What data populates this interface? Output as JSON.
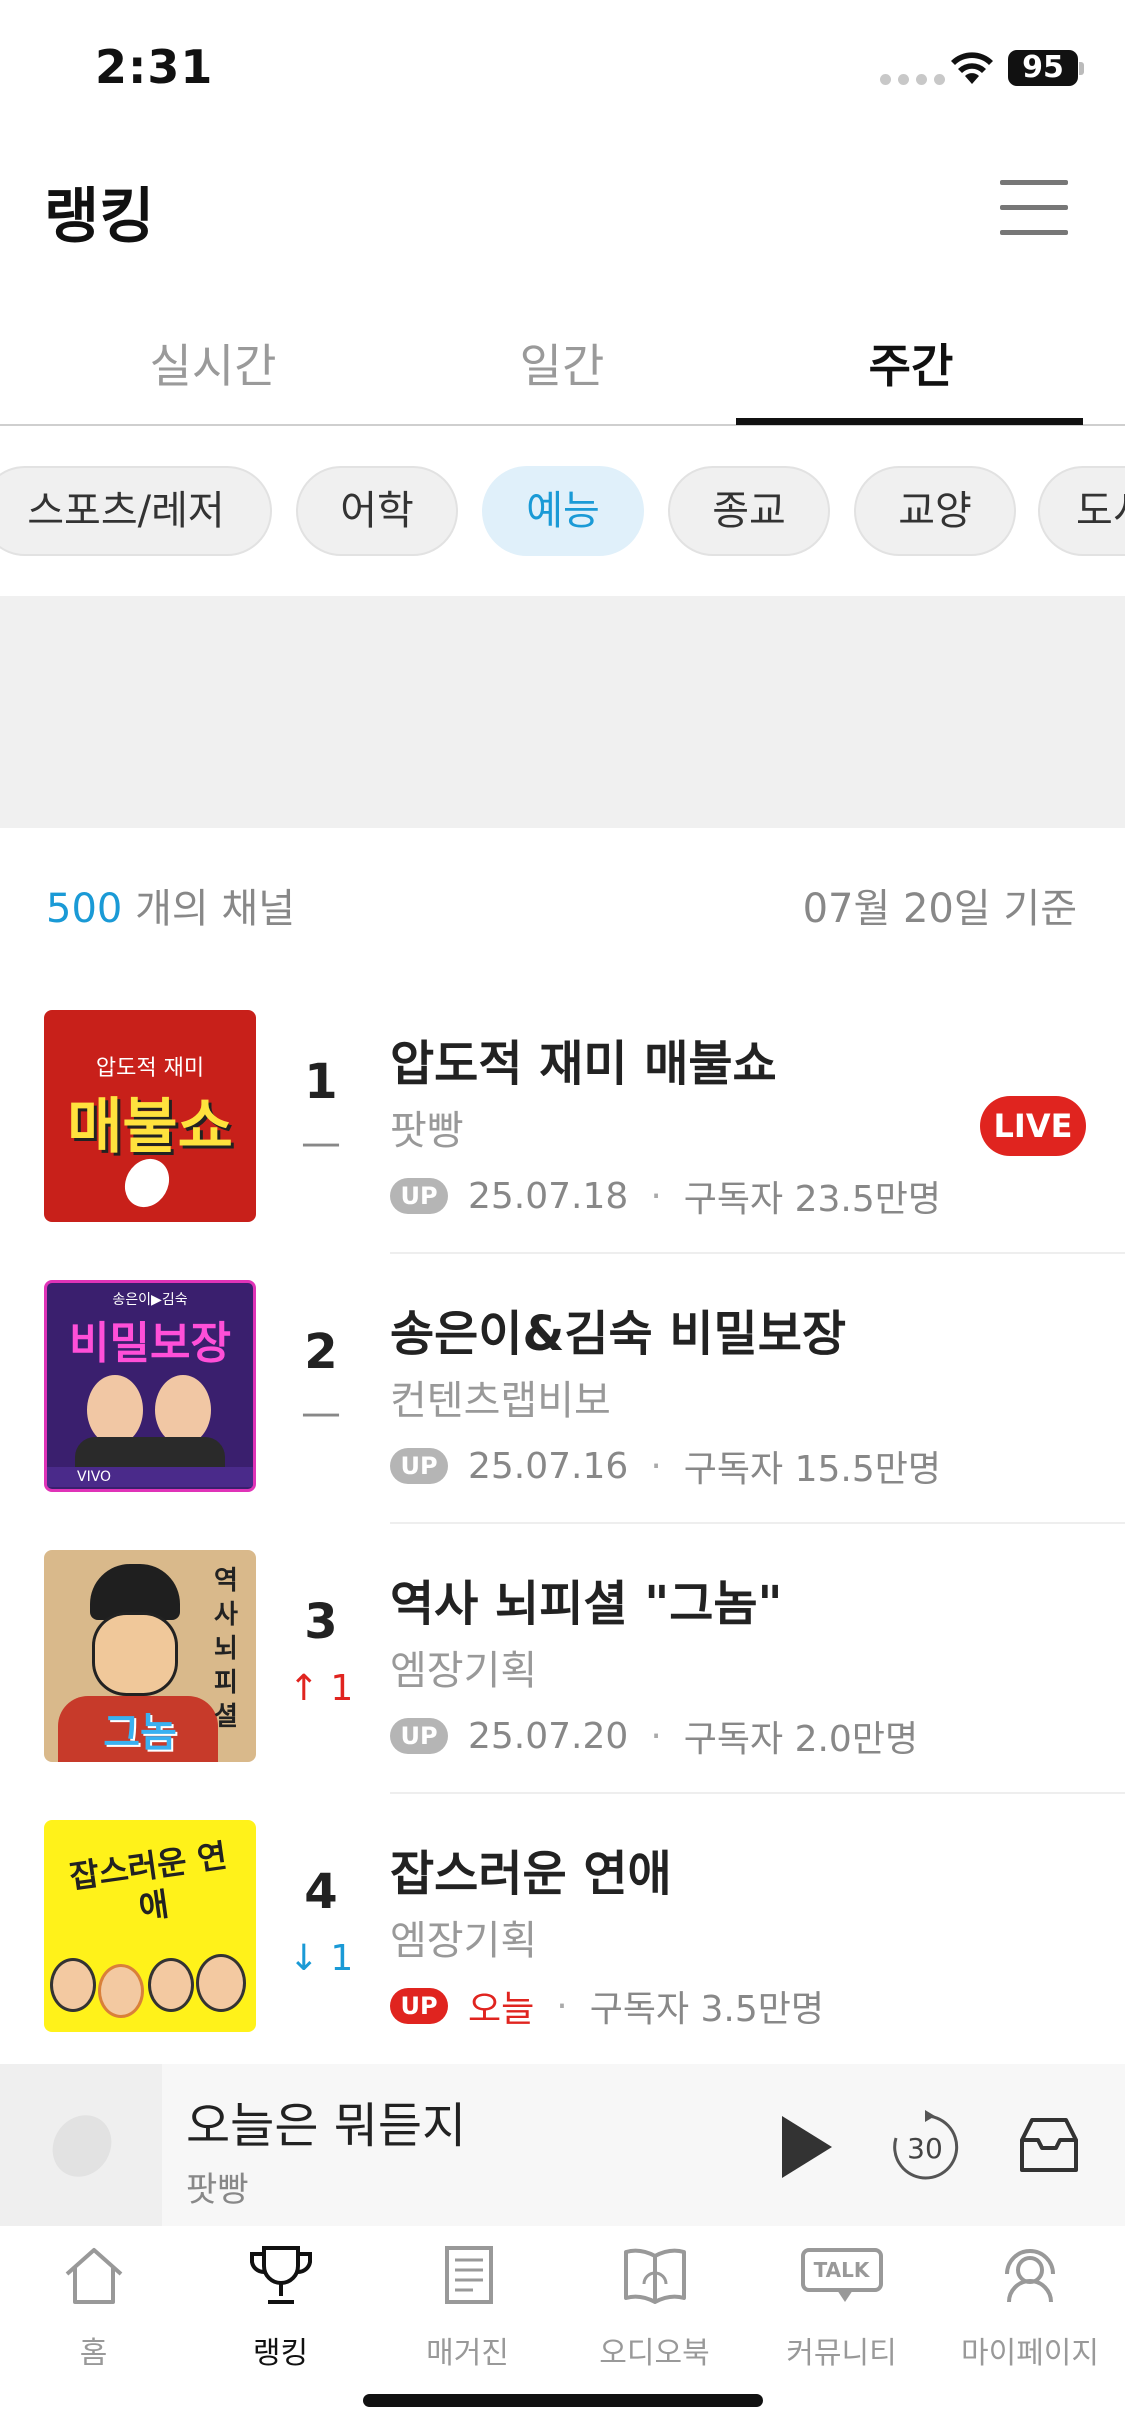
{
  "status_bar": {
    "time": "2:31",
    "battery": "95"
  },
  "header": {
    "title": "랭킹"
  },
  "tabs": [
    {
      "label": "실시간",
      "active": false
    },
    {
      "label": "일간",
      "active": false
    },
    {
      "label": "주간",
      "active": true
    }
  ],
  "categories": [
    {
      "label": "스포츠/레저",
      "active": false
    },
    {
      "label": "어학",
      "active": false
    },
    {
      "label": "예능",
      "active": true
    },
    {
      "label": "종교",
      "active": false
    },
    {
      "label": "교양",
      "active": false
    },
    {
      "label": "도서",
      "active": false
    }
  ],
  "summary": {
    "count": "500",
    "count_suffix": "개의 채널",
    "date_basis": "07월 20일 기준"
  },
  "rankings": [
    {
      "rank": "1",
      "change": "—",
      "change_type": "same",
      "title": "압도적 재미 매불쇼",
      "creator": "팟빵",
      "badge": "UP",
      "date": "25.07.18",
      "subscribers": "구독자 23.5만명",
      "live": "LIVE",
      "thumb": {
        "top": "압도적 재미",
        "main": "매불쇼"
      }
    },
    {
      "rank": "2",
      "change": "—",
      "change_type": "same",
      "title": "송은이&김숙 비밀보장",
      "creator": "컨텐츠랩비보",
      "badge": "UP",
      "date": "25.07.16",
      "subscribers": "구독자 15.5만명",
      "thumb": {
        "top": "송은이▶김숙",
        "main": "비밀보장",
        "footer": "VIVO"
      }
    },
    {
      "rank": "3",
      "change": "↑ 1",
      "change_type": "up",
      "title": "역사 뇌피셜 \"그놈\"",
      "creator": "엠장기획",
      "badge": "UP",
      "date": "25.07.20",
      "subscribers": "구독자 2.0만명",
      "thumb": {
        "side": "역사뇌피셜",
        "main": "그놈"
      }
    },
    {
      "rank": "4",
      "change": "↓ 1",
      "change_type": "down",
      "title": "잡스러운 연애",
      "creator": "엠장기획",
      "badge": "UP",
      "date": "오늘",
      "subscribers": "구독자 3.5만명",
      "thumb": {
        "main": "잡스러운 연애"
      }
    }
  ],
  "mini_player": {
    "title": "오늘은 뭐듣지",
    "subtitle": "팟빵",
    "skip_label": "30"
  },
  "bottom_nav": [
    {
      "label": "홈",
      "icon": "home-icon",
      "active": false
    },
    {
      "label": "랭킹",
      "icon": "trophy-icon",
      "active": true
    },
    {
      "label": "매거진",
      "icon": "magazine-icon",
      "active": false
    },
    {
      "label": "오디오북",
      "icon": "audiobook-icon",
      "active": false
    },
    {
      "label": "커뮤니티",
      "icon": "talk-icon",
      "active": false,
      "icon_text": "TALK"
    },
    {
      "label": "마이페이지",
      "icon": "headphones-person-icon",
      "active": false
    }
  ],
  "colors": {
    "accent": "#1a9ad6",
    "live": "#e0241f",
    "up": "#e0241f",
    "down": "#1a9ad6"
  }
}
